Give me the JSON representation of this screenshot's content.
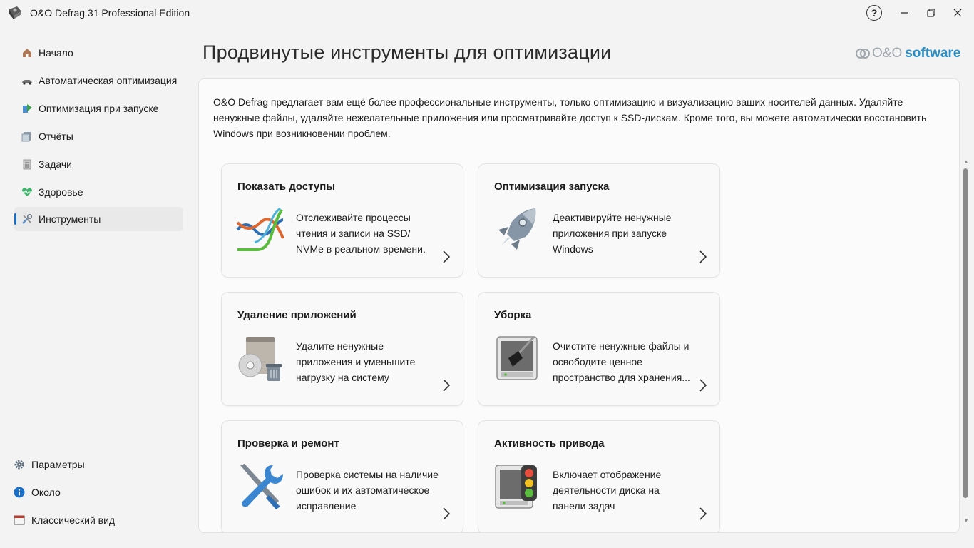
{
  "window": {
    "title": "O&O Defrag 31 Professional Edition",
    "help_glyph": "?",
    "minimize_glyph": "—",
    "maximize_glyph": "❐",
    "close_glyph": "✕"
  },
  "sidebar": {
    "items": [
      {
        "label": "Начало",
        "icon": "home-icon"
      },
      {
        "label": "Автоматическая оптимизация",
        "icon": "car-icon"
      },
      {
        "label": "Оптимизация при запуске",
        "icon": "boot-icon"
      },
      {
        "label": "Отчёты",
        "icon": "reports-icon"
      },
      {
        "label": "Задачи",
        "icon": "tasks-icon"
      },
      {
        "label": "Здоровье",
        "icon": "heart-icon"
      },
      {
        "label": "Инструменты",
        "icon": "tools-icon",
        "active": true
      }
    ],
    "bottom": [
      {
        "label": "Параметры",
        "icon": "gear-icon"
      },
      {
        "label": "Около",
        "icon": "info-icon"
      },
      {
        "label": "Классический вид",
        "icon": "window-icon"
      }
    ]
  },
  "header": {
    "title": "Продвинутые инструменты для оптимизации",
    "brand_prefix": "O&O",
    "brand_suffix": "software"
  },
  "main": {
    "intro": "O&O Defrag предлагает вам ещё более профессиональные инструменты, только оптимизацию и визуализацию ваших носителей данных. Удаляйте ненужные файлы, удаляйте нежелательные приложения или просматривайте доступ к SSD-дискам. Кроме того, вы можете автоматически восстановить Windows при возникновении проблем.",
    "cards": [
      {
        "title": "Показать доступы",
        "description": "Отслеживайте процессы чтения и записи на SSD/ NVMe в реальном времени.",
        "icon": "access-graph-icon"
      },
      {
        "title": "Оптимизация запуска",
        "description": "Деактивируйте ненужные приложения при запуске Windows",
        "icon": "rocket-icon"
      },
      {
        "title": "Удаление приложений",
        "description": "Удалите ненужные приложения и уменьшите нагрузку на систему",
        "icon": "uninstall-icon"
      },
      {
        "title": "Уборка",
        "description": "Очистите ненужные файлы и освободите ценное пространство для хранения...",
        "icon": "broom-drive-icon"
      },
      {
        "title": "Проверка и ремонт",
        "description": "Проверка системы на наличие ошибок и их автоматическое исправление",
        "icon": "wrench-screwdriver-icon"
      },
      {
        "title": "Активность привода",
        "description": "Включает отображение деятельности диска на панели задач",
        "icon": "traffic-light-drive-icon"
      }
    ]
  },
  "colors": {
    "accent": "#1a6ec6",
    "brand_blue": "#2a8fc7",
    "background": "#f3f3f3"
  }
}
